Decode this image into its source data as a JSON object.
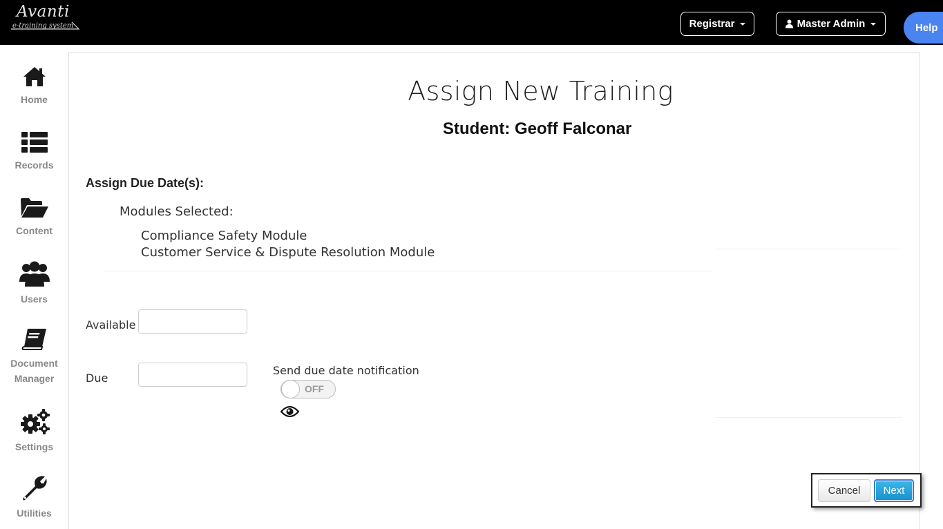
{
  "header": {
    "logo_brand": "Avanti",
    "logo_tag": "e-training system",
    "registrar_label": "Registrar",
    "admin_label": "Master Admin",
    "help_label": "Help"
  },
  "sidebar": {
    "items": [
      {
        "label": "Home",
        "icon": "home-icon"
      },
      {
        "label": "Records",
        "icon": "list-icon"
      },
      {
        "label": "Content",
        "icon": "folder-open-icon"
      },
      {
        "label": "Users",
        "icon": "users-icon"
      },
      {
        "label": "Document",
        "label2": "Manager",
        "icon": "book-icon"
      },
      {
        "label": "Settings",
        "icon": "cogs-icon"
      },
      {
        "label": "Utilities",
        "icon": "wrench-icon"
      }
    ]
  },
  "main": {
    "title": "Assign New Training",
    "student": "Student: Geoff Falconar",
    "assign_due_heading": "Assign Due Date(s):",
    "modules_label": "Modules Selected:",
    "modules": [
      "Compliance Safety Module",
      "Customer Service & Dispute Resolution Module"
    ],
    "available_label": "Available",
    "available_value": "",
    "due_label": "Due",
    "due_value": "",
    "notify_label": "Send due date notification",
    "toggle_state": "OFF"
  },
  "actions": {
    "cancel_label": "Cancel",
    "next_label": "Next"
  },
  "colors": {
    "topbar": "#000000",
    "help": "#4a84f0",
    "next": "#1a8fcf"
  }
}
